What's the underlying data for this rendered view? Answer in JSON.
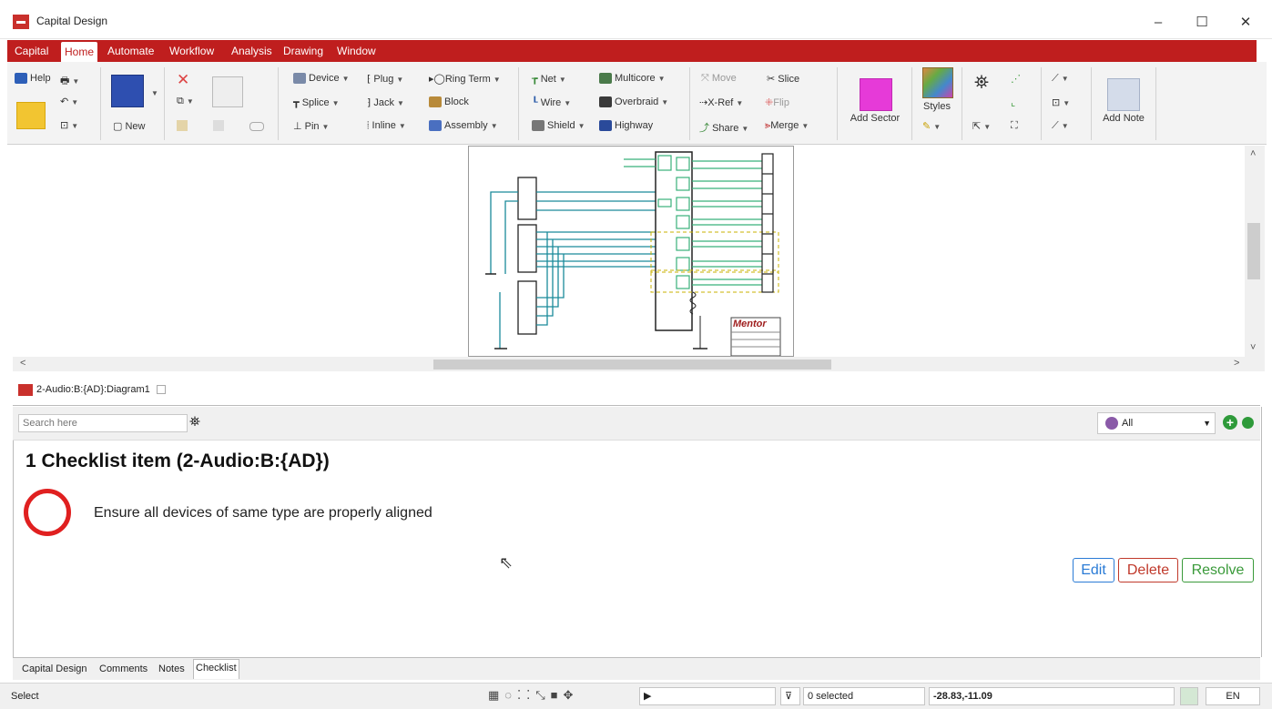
{
  "window": {
    "title": "Capital Design",
    "minimize": "–",
    "maximize": "☐",
    "close": "✕"
  },
  "menu": [
    "Capital",
    "Home",
    "Automate",
    "Workflow",
    "Analysis",
    "Drawing",
    "Window"
  ],
  "menu_active": "Home",
  "ribbon": {
    "help": "Help",
    "new": "New",
    "device": "Device",
    "plug": "Plug",
    "ring_term": "Ring Term",
    "splice": "Splice",
    "jack": "Jack",
    "block": "Block",
    "pin": "Pin",
    "inline": "Inline",
    "assembly": "Assembly",
    "net": "Net",
    "multicore": "Multicore",
    "wire": "Wire",
    "overbraid": "Overbraid",
    "shield": "Shield",
    "highway": "Highway",
    "move": "Move",
    "slice": "Slice",
    "xref": "X-Ref",
    "flip": "Flip",
    "share": "Share",
    "merge": "Merge",
    "add_sector": "Add Sector",
    "styles": "Styles",
    "add_note": "Add Note"
  },
  "diagram": {
    "title_block_text": "Mentor"
  },
  "doc_tab": {
    "label": "2-Audio:B:{AD}:Diagram1"
  },
  "checklist": {
    "search_placeholder": "Search here",
    "filter_value": "All",
    "heading": "1 Checklist item (2-Audio:B:{AD})",
    "item_text": "Ensure all devices of same type are properly aligned",
    "edit": "Edit",
    "delete": "Delete",
    "resolve": "Resolve"
  },
  "bottom_tabs": [
    "Capital Design",
    "Comments",
    "Notes",
    "Checklist"
  ],
  "bottom_tab_active": "Checklist",
  "status": {
    "mode": "Select",
    "selected": "0 selected",
    "coords": "-28.83,-11.09",
    "lang": "EN"
  },
  "colors": {
    "brand_red": "#bf1e1e",
    "edit": "#2a7bd6",
    "delete": "#c0392b",
    "resolve": "#3a9a3a",
    "wire_teal": "#1a8a9a",
    "wire_green": "#38b07a"
  }
}
